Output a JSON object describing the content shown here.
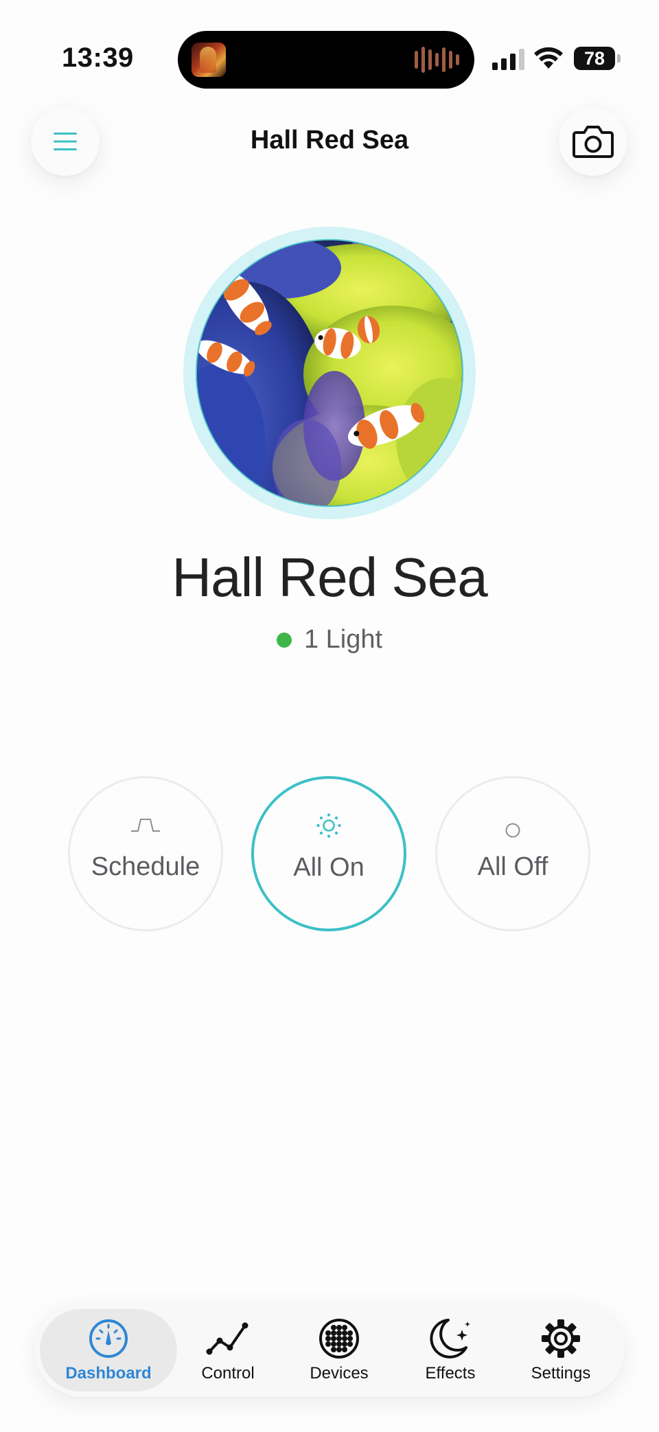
{
  "status_bar": {
    "time": "13:39",
    "battery": "78",
    "icons": [
      "now-playing-artwork",
      "audio-waveform",
      "cellular-signal",
      "wifi",
      "battery"
    ]
  },
  "header": {
    "title": "Hall Red Sea",
    "menu_icon": "hamburger-menu-icon",
    "camera_icon": "camera-icon"
  },
  "tank": {
    "name": "Hall Red Sea",
    "status_text": "1 Light",
    "status_color": "#3fb64a",
    "ring_color": "#d3f3f6",
    "photo": "clownfish-on-anemones"
  },
  "modes": [
    {
      "label": "Schedule",
      "icon": "schedule-pulse-icon",
      "active": false
    },
    {
      "label": "All On",
      "icon": "sun-icon",
      "active": true
    },
    {
      "label": "All Off",
      "icon": "circle-off-icon",
      "active": false
    }
  ],
  "tabs": [
    {
      "label": "Dashboard",
      "icon": "gauge-icon",
      "active": true
    },
    {
      "label": "Control",
      "icon": "line-chart-icon",
      "active": false
    },
    {
      "label": "Devices",
      "icon": "led-grid-icon",
      "active": false
    },
    {
      "label": "Effects",
      "icon": "moon-stars-icon",
      "active": false
    },
    {
      "label": "Settings",
      "icon": "gear-icon",
      "active": false
    }
  ],
  "colors": {
    "accent": "#3cc0c6",
    "tab_active": "#2f86d4",
    "text_primary": "#111111",
    "text_secondary": "#5b5b60"
  }
}
